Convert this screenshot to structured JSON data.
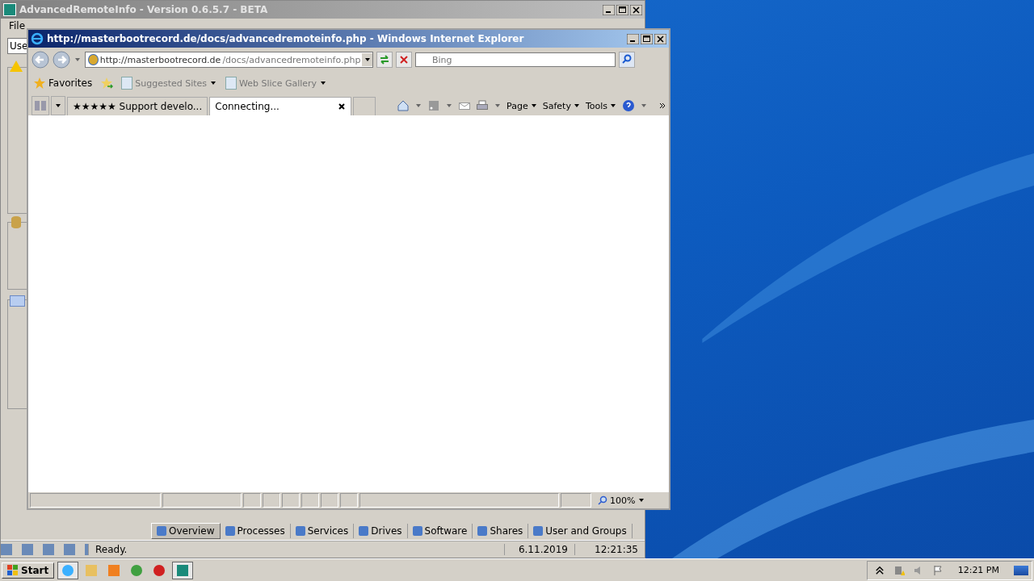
{
  "back_window": {
    "title": "AdvancedRemoteInfo - Version 0.6.5.7 - BETA",
    "menu": [
      "File"
    ],
    "user_field": "Use",
    "tabs": [
      {
        "label": "Overview",
        "selected": true
      },
      {
        "label": "Processes",
        "selected": false
      },
      {
        "label": "Services",
        "selected": false
      },
      {
        "label": "Drives",
        "selected": false
      },
      {
        "label": "Software",
        "selected": false
      },
      {
        "label": "Shares",
        "selected": false
      },
      {
        "label": "User and Groups",
        "selected": false
      }
    ],
    "status_bar": {
      "message": "Ready.",
      "date": "6.11.2019",
      "time": "12:21:35"
    }
  },
  "browser": {
    "title": "http://masterbootrecord.de/docs/advancedremoteinfo.php - Windows Internet Explorer",
    "address": {
      "host": "http://masterbootrecord.de",
      "path": "/docs/advancedremoteinfo.php"
    },
    "search": {
      "placeholder": "Bing"
    },
    "favorites": [
      {
        "label": "Favorites",
        "kind": "favorites"
      },
      {
        "label": "Suggested Sites",
        "kind": "link"
      },
      {
        "label": "Web Slice Gallery",
        "kind": "link"
      }
    ],
    "tabs": [
      {
        "label": "★★★★★ Support develo...",
        "selected": false,
        "closable": false
      },
      {
        "label": "Connecting...",
        "selected": true,
        "closable": true
      }
    ],
    "commands": [
      "Page",
      "Safety",
      "Tools"
    ],
    "zoom": "100%"
  },
  "taskbar": {
    "start": "Start",
    "clock": "12:21 PM"
  }
}
